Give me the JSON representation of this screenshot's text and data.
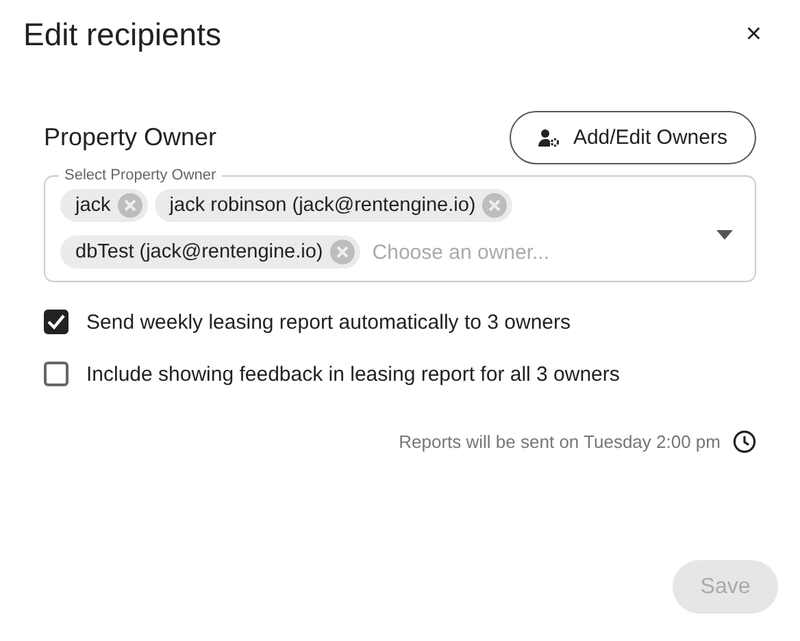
{
  "dialog": {
    "title": "Edit recipients",
    "close": "×"
  },
  "owner_section": {
    "heading": "Property Owner",
    "add_button": "Add/Edit Owners"
  },
  "select": {
    "label": "Select Property Owner",
    "placeholder": "Choose an owner...",
    "chips": [
      {
        "label": "jack"
      },
      {
        "label": "jack robinson (jack@rentengine.io)"
      },
      {
        "label": "dbTest (jack@rentengine.io)"
      }
    ]
  },
  "options": [
    {
      "label": "Send weekly leasing report automatically to 3 owners",
      "checked": true
    },
    {
      "label": "Include showing feedback in leasing report for all 3 owners",
      "checked": false
    }
  ],
  "schedule": "Reports will be sent on Tuesday 2:00 pm",
  "save_button": {
    "label": "Save",
    "disabled": true
  }
}
